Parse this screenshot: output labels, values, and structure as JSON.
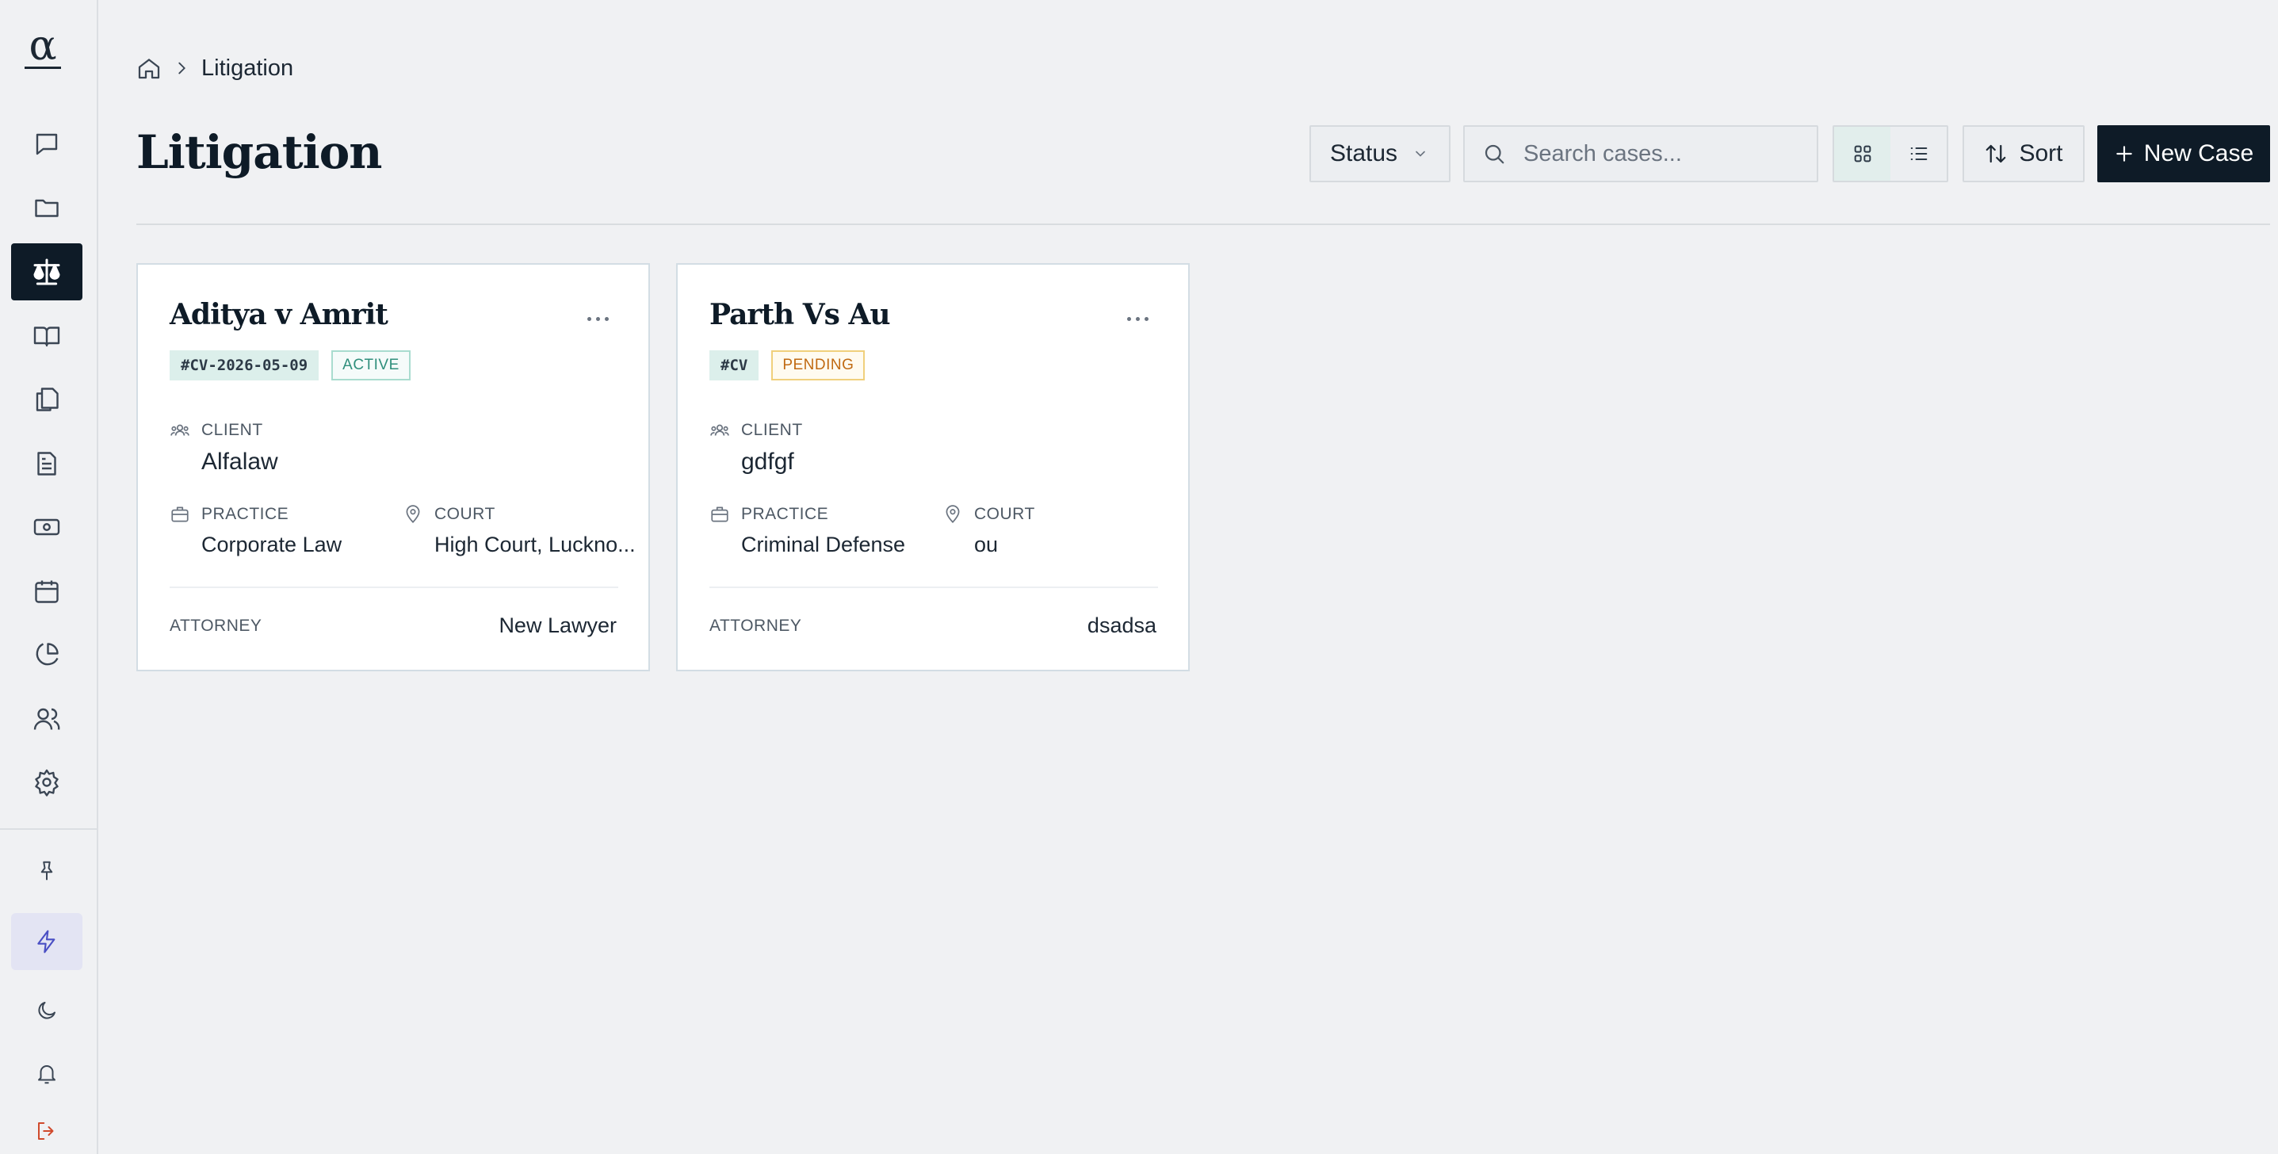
{
  "sidebar": {
    "logo": "α",
    "items": [
      {
        "icon": "message-icon",
        "name": "sidebar-item-messages"
      },
      {
        "icon": "folder-icon",
        "name": "sidebar-item-files"
      },
      {
        "icon": "scale-icon",
        "name": "sidebar-item-litigation",
        "active": true
      },
      {
        "icon": "book-icon",
        "name": "sidebar-item-library"
      },
      {
        "icon": "documents-icon",
        "name": "sidebar-item-documents"
      },
      {
        "icon": "file-text-icon",
        "name": "sidebar-item-drafts"
      },
      {
        "icon": "cash-icon",
        "name": "sidebar-item-billing"
      },
      {
        "icon": "calendar-icon",
        "name": "sidebar-item-calendar"
      },
      {
        "icon": "pie-chart-icon",
        "name": "sidebar-item-analytics"
      },
      {
        "icon": "users-icon",
        "name": "sidebar-item-team"
      },
      {
        "icon": "gear-icon",
        "name": "sidebar-item-settings"
      }
    ],
    "bottom_items": [
      {
        "icon": "pin-icon",
        "name": "pin-button"
      },
      {
        "icon": "lightning-icon",
        "name": "quick-actions-button"
      },
      {
        "icon": "moon-icon",
        "name": "theme-toggle-button"
      },
      {
        "icon": "bell-icon",
        "name": "notifications-button"
      },
      {
        "icon": "logout-icon",
        "name": "logout-button"
      }
    ]
  },
  "breadcrumb": {
    "current": "Litigation"
  },
  "page": {
    "title": "Litigation"
  },
  "toolbar": {
    "status_label": "Status",
    "search_placeholder": "Search cases...",
    "sort_label": "Sort",
    "new_case_label": "New Case",
    "view_mode": "grid"
  },
  "colors": {
    "primary": "#0e1b27",
    "background": "#f0f1f3",
    "active_badge": "#2f8f7c",
    "pending_badge": "#c06a12",
    "accent_soft": "#4a4fc4"
  },
  "cases": [
    {
      "title": "Aditya v Amrit",
      "case_id": "#CV-2026-05-09",
      "status": "ACTIVE",
      "client_label": "CLIENT",
      "client": "Alfalaw",
      "practice_label": "PRACTICE",
      "practice": "Corporate Law",
      "court_label": "COURT",
      "court": "High Court, Luckno...",
      "attorney_label": "ATTORNEY",
      "attorney": "New Lawyer"
    },
    {
      "title": "Parth Vs Au",
      "case_id": "#CV",
      "status": "PENDING",
      "client_label": "CLIENT",
      "client": "gdfgf",
      "practice_label": "PRACTICE",
      "practice": "Criminal Defense",
      "court_label": "COURT",
      "court": "ou",
      "attorney_label": "ATTORNEY",
      "attorney": "dsadsa"
    }
  ]
}
